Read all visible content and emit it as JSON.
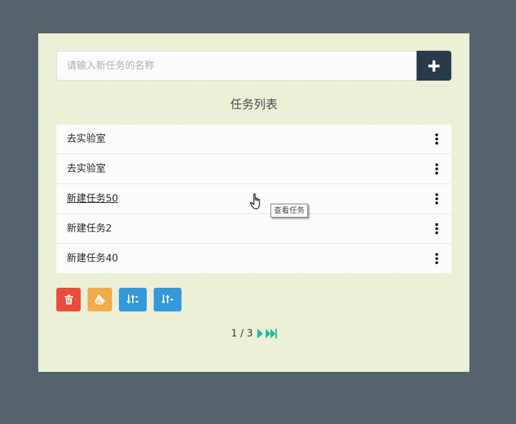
{
  "input": {
    "placeholder": "请输入新任务的名称",
    "value": ""
  },
  "add_button": {
    "icon": "plus-icon"
  },
  "list": {
    "title": "任务列表",
    "items": [
      {
        "name": "去实验室",
        "menu_icon": "more-vertical-icon"
      },
      {
        "name": "去实验室",
        "menu_icon": "more-vertical-icon"
      },
      {
        "name": "新建任务50",
        "menu_icon": "more-vertical-icon"
      },
      {
        "name": "新建任务2",
        "menu_icon": "more-vertical-icon"
      },
      {
        "name": "新建任务40",
        "menu_icon": "more-vertical-icon"
      }
    ]
  },
  "toolbar": {
    "buttons": [
      {
        "icon": "trash-icon",
        "color": "#e74c3c"
      },
      {
        "icon": "eraser-icon",
        "color": "#f0ad4e"
      },
      {
        "icon": "sort-desc-icon",
        "color": "#3498db"
      },
      {
        "icon": "sort-asc-icon",
        "color": "#3498db"
      }
    ]
  },
  "pagination": {
    "text": "1 / 3",
    "current_page": 1,
    "total_pages": 3,
    "next_icon": "caret-right-icon",
    "last_icon": "fast-forward-icon",
    "accent": "#1abc9c"
  },
  "tooltip": {
    "text": "查看任务"
  },
  "colors": {
    "page_bg": "#566470",
    "card_bg": "#eef0d8",
    "add_button_bg": "#2b3a4a"
  }
}
